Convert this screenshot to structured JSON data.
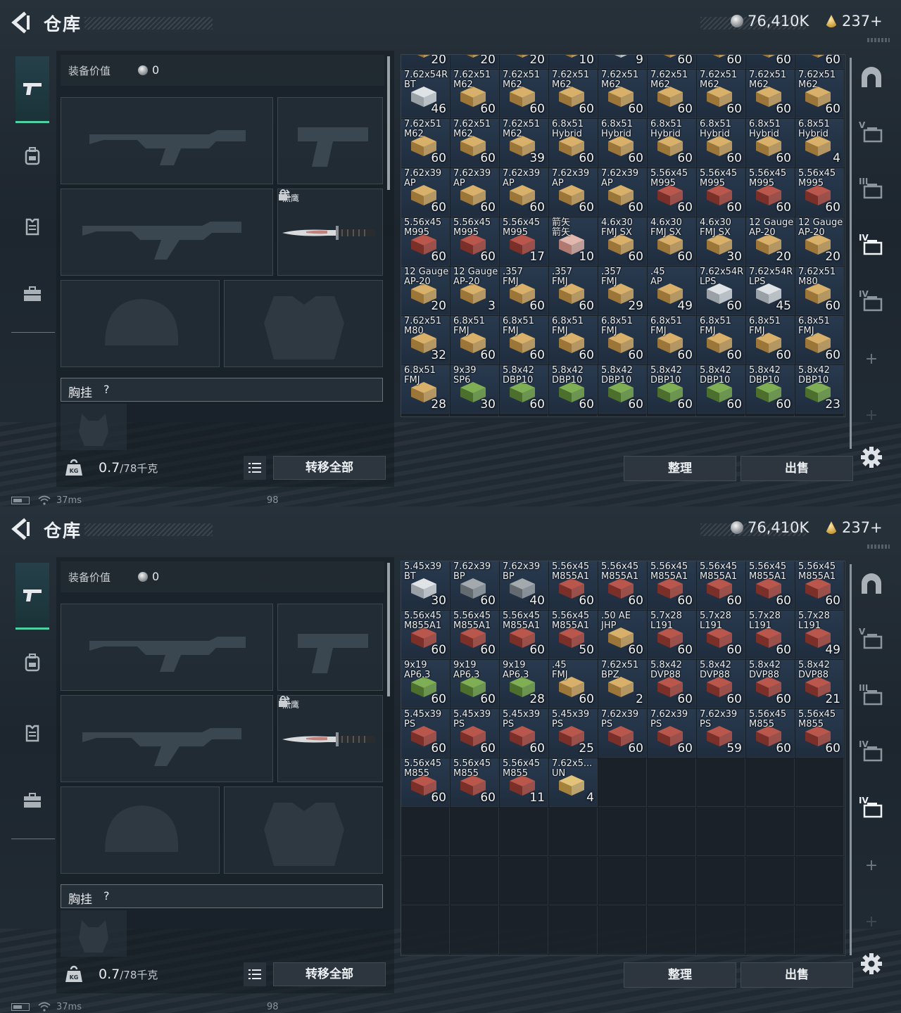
{
  "screens": [
    {
      "title": "仓库",
      "currency": {
        "silver": "76,410K",
        "gold": "237+"
      },
      "equip_value": {
        "label": "装备价值",
        "value": "0"
      },
      "knife_name": "黑鹰",
      "rig_label": "胸挂",
      "rig_help": "?",
      "weight": {
        "current": "0.7",
        "max": "/78千克"
      },
      "buttons": {
        "transfer_all": "转移全部",
        "sort": "整理",
        "sell": "出售"
      },
      "status": {
        "ping": "37ms",
        "fps": "98"
      },
      "grid_scroll_offset_rows": 0.7,
      "grid_rows": 8,
      "items": [
        {
          "name": "",
          "qty": "20",
          "color": "gold"
        },
        {
          "name": "",
          "qty": "20",
          "color": "gold"
        },
        {
          "name": "",
          "qty": "20",
          "color": "gold"
        },
        {
          "name": "",
          "qty": "10",
          "color": "gold"
        },
        {
          "name": "",
          "qty": "9",
          "color": "white"
        },
        {
          "name": "",
          "qty": "60",
          "color": "gold"
        },
        {
          "name": "",
          "qty": "60",
          "color": "gold"
        },
        {
          "name": "",
          "qty": "60",
          "color": "gold"
        },
        {
          "name": "",
          "qty": "60",
          "color": "gold"
        },
        {
          "name": "7.62x54R\nBT",
          "qty": "46",
          "color": "white"
        },
        {
          "name": "7.62x51\nM62",
          "qty": "60",
          "color": "gold"
        },
        {
          "name": "7.62x51\nM62",
          "qty": "60",
          "color": "gold"
        },
        {
          "name": "7.62x51\nM62",
          "qty": "60",
          "color": "gold"
        },
        {
          "name": "7.62x51\nM62",
          "qty": "60",
          "color": "gold"
        },
        {
          "name": "7.62x51\nM62",
          "qty": "60",
          "color": "gold"
        },
        {
          "name": "7.62x51\nM62",
          "qty": "60",
          "color": "gold"
        },
        {
          "name": "7.62x51\nM62",
          "qty": "60",
          "color": "gold"
        },
        {
          "name": "7.62x51\nM62",
          "qty": "60",
          "color": "gold"
        },
        {
          "name": "7.62x51\nM62",
          "qty": "60",
          "color": "gold"
        },
        {
          "name": "7.62x51\nM62",
          "qty": "60",
          "color": "gold"
        },
        {
          "name": "7.62x51\nM62",
          "qty": "39",
          "color": "gold"
        },
        {
          "name": "6.8x51\nHybrid",
          "qty": "60",
          "color": "gold"
        },
        {
          "name": "6.8x51\nHybrid",
          "qty": "60",
          "color": "gold"
        },
        {
          "name": "6.8x51\nHybrid",
          "qty": "60",
          "color": "gold"
        },
        {
          "name": "6.8x51\nHybrid",
          "qty": "60",
          "color": "gold"
        },
        {
          "name": "6.8x51\nHybrid",
          "qty": "60",
          "color": "gold"
        },
        {
          "name": "6.8x51\nHybrid",
          "qty": "4",
          "color": "gold"
        },
        {
          "name": "7.62x39\nAP",
          "qty": "60",
          "color": "gold"
        },
        {
          "name": "7.62x39\nAP",
          "qty": "60",
          "color": "gold"
        },
        {
          "name": "7.62x39\nAP",
          "qty": "60",
          "color": "gold"
        },
        {
          "name": "7.62x39\nAP",
          "qty": "60",
          "color": "gold"
        },
        {
          "name": "7.62x39\nAP",
          "qty": "60",
          "color": "gold"
        },
        {
          "name": "5.56x45\nM995",
          "qty": "60",
          "color": "red"
        },
        {
          "name": "5.56x45\nM995",
          "qty": "60",
          "color": "red"
        },
        {
          "name": "5.56x45\nM995",
          "qty": "60",
          "color": "red"
        },
        {
          "name": "5.56x45\nM995",
          "qty": "60",
          "color": "red"
        },
        {
          "name": "5.56x45\nM995",
          "qty": "60",
          "color": "red"
        },
        {
          "name": "5.56x45\nM995",
          "qty": "60",
          "color": "red"
        },
        {
          "name": "5.56x45\nM995",
          "qty": "17",
          "color": "red"
        },
        {
          "name": "箭矢\n箭矢",
          "qty": "10",
          "color": "pink"
        },
        {
          "name": "4.6x30\nFMJ SX",
          "qty": "60",
          "color": "gold"
        },
        {
          "name": "4.6x30\nFMJ SX",
          "qty": "60",
          "color": "gold"
        },
        {
          "name": "4.6x30\nFMJ SX",
          "qty": "30",
          "color": "gold"
        },
        {
          "name": "12 Gauge\nAP-20",
          "qty": "20",
          "color": "gold"
        },
        {
          "name": "12 Gauge\nAP-20",
          "qty": "20",
          "color": "gold"
        },
        {
          "name": "12 Gauge\nAP-20",
          "qty": "20",
          "color": "gold"
        },
        {
          "name": "12 Gauge\nAP-20",
          "qty": "3",
          "color": "gold"
        },
        {
          "name": ".357\nFMJ",
          "qty": "60",
          "color": "gold"
        },
        {
          "name": ".357\nFMJ",
          "qty": "60",
          "color": "gold"
        },
        {
          "name": ".357\nFMJ",
          "qty": "29",
          "color": "gold"
        },
        {
          "name": ".45\nAP",
          "qty": "49",
          "color": "gold"
        },
        {
          "name": "7.62x54R\nLPS",
          "qty": "60",
          "color": "white"
        },
        {
          "name": "7.62x54R\nLPS",
          "qty": "45",
          "color": "white"
        },
        {
          "name": "7.62x51\nM80",
          "qty": "60",
          "color": "gold"
        },
        {
          "name": "7.62x51\nM80",
          "qty": "32",
          "color": "gold"
        },
        {
          "name": "6.8x51\nFMJ",
          "qty": "60",
          "color": "gold"
        },
        {
          "name": "6.8x51\nFMJ",
          "qty": "60",
          "color": "gold"
        },
        {
          "name": "6.8x51\nFMJ",
          "qty": "60",
          "color": "gold"
        },
        {
          "name": "6.8x51\nFMJ",
          "qty": "60",
          "color": "gold"
        },
        {
          "name": "6.8x51\nFMJ",
          "qty": "60",
          "color": "gold"
        },
        {
          "name": "6.8x51\nFMJ",
          "qty": "60",
          "color": "gold"
        },
        {
          "name": "6.8x51\nFMJ",
          "qty": "60",
          "color": "gold"
        },
        {
          "name": "6.8x51\nFMJ",
          "qty": "60",
          "color": "gold"
        },
        {
          "name": "6.8x51\nFMJ",
          "qty": "28",
          "color": "gold"
        },
        {
          "name": "9x39\nSP6",
          "qty": "30",
          "color": "green"
        },
        {
          "name": "5.8x42\nDBP10",
          "qty": "60",
          "color": "green"
        },
        {
          "name": "5.8x42\nDBP10",
          "qty": "60",
          "color": "green"
        },
        {
          "name": "5.8x42\nDBP10",
          "qty": "60",
          "color": "green"
        },
        {
          "name": "5.8x42\nDBP10",
          "qty": "60",
          "color": "green"
        },
        {
          "name": "5.8x42\nDBP10",
          "qty": "60",
          "color": "green"
        },
        {
          "name": "5.8x42\nDBP10",
          "qty": "60",
          "color": "green"
        },
        {
          "name": "5.8x42\nDBP10",
          "qty": "23",
          "color": "green"
        }
      ]
    },
    {
      "title": "仓库",
      "currency": {
        "silver": "76,410K",
        "gold": "237+"
      },
      "equip_value": {
        "label": "装备价值",
        "value": "0"
      },
      "knife_name": "黑鹰",
      "rig_label": "胸挂",
      "rig_help": "?",
      "weight": {
        "current": "0.7",
        "max": "/78千克"
      },
      "buttons": {
        "transfer_all": "转移全部",
        "sort": "整理",
        "sell": "出售"
      },
      "status": {
        "ping": "37ms",
        "fps": "98"
      },
      "grid_scroll_offset_rows": 0,
      "grid_rows": 8,
      "items": [
        {
          "name": "5.45x39\nBT",
          "qty": "30",
          "color": "white"
        },
        {
          "name": "7.62x39\nBP",
          "qty": "60",
          "color": "gray"
        },
        {
          "name": "7.62x39\nBP",
          "qty": "40",
          "color": "gray"
        },
        {
          "name": "5.56x45\nM855A1",
          "qty": "60",
          "color": "red"
        },
        {
          "name": "5.56x45\nM855A1",
          "qty": "60",
          "color": "red"
        },
        {
          "name": "5.56x45\nM855A1",
          "qty": "60",
          "color": "red"
        },
        {
          "name": "5.56x45\nM855A1",
          "qty": "60",
          "color": "red"
        },
        {
          "name": "5.56x45\nM855A1",
          "qty": "60",
          "color": "red"
        },
        {
          "name": "5.56x45\nM855A1",
          "qty": "60",
          "color": "red"
        },
        {
          "name": "5.56x45\nM855A1",
          "qty": "60",
          "color": "red"
        },
        {
          "name": "5.56x45\nM855A1",
          "qty": "60",
          "color": "red"
        },
        {
          "name": "5.56x45\nM855A1",
          "qty": "60",
          "color": "red"
        },
        {
          "name": "5.56x45\nM855A1",
          "qty": "50",
          "color": "red"
        },
        {
          "name": ".50 AE\nJHP",
          "qty": "60",
          "color": "gold"
        },
        {
          "name": "5.7x28\nL191",
          "qty": "60",
          "color": "red"
        },
        {
          "name": "5.7x28\nL191",
          "qty": "60",
          "color": "red"
        },
        {
          "name": "5.7x28\nL191",
          "qty": "60",
          "color": "red"
        },
        {
          "name": "5.7x28\nL191",
          "qty": "49",
          "color": "red"
        },
        {
          "name": "9x19\nAP6.3",
          "qty": "60",
          "color": "green"
        },
        {
          "name": "9x19\nAP6.3",
          "qty": "60",
          "color": "green"
        },
        {
          "name": "9x19\nAP6.3",
          "qty": "28",
          "color": "green"
        },
        {
          "name": ".45\nFMJ",
          "qty": "60",
          "color": "gold"
        },
        {
          "name": "7.62x51\nBPZ",
          "qty": "2",
          "color": "gold"
        },
        {
          "name": "5.8x42\nDVP88",
          "qty": "60",
          "color": "red"
        },
        {
          "name": "5.8x42\nDVP88",
          "qty": "60",
          "color": "red"
        },
        {
          "name": "5.8x42\nDVP88",
          "qty": "60",
          "color": "red"
        },
        {
          "name": "5.8x42\nDVP88",
          "qty": "21",
          "color": "red"
        },
        {
          "name": "5.45x39\nPS",
          "qty": "60",
          "color": "red"
        },
        {
          "name": "5.45x39\nPS",
          "qty": "60",
          "color": "red"
        },
        {
          "name": "5.45x39\nPS",
          "qty": "60",
          "color": "red"
        },
        {
          "name": "5.45x39\nPS",
          "qty": "25",
          "color": "red"
        },
        {
          "name": "7.62x39\nPS",
          "qty": "60",
          "color": "red"
        },
        {
          "name": "7.62x39\nPS",
          "qty": "60",
          "color": "red"
        },
        {
          "name": "7.62x39\nPS",
          "qty": "59",
          "color": "red"
        },
        {
          "name": "5.56x45\nM855",
          "qty": "60",
          "color": "red"
        },
        {
          "name": "5.56x45\nM855",
          "qty": "60",
          "color": "red"
        },
        {
          "name": "5.56x45\nM855",
          "qty": "60",
          "color": "red"
        },
        {
          "name": "5.56x45\nM855",
          "qty": "60",
          "color": "red"
        },
        {
          "name": "5.56x45\nM855",
          "qty": "11",
          "color": "red"
        },
        {
          "name": "7.62x5...\nUN",
          "qty": "4",
          "color": "yellow"
        }
      ]
    }
  ],
  "colors": {
    "accent": "#4fd1a5",
    "box_gold": "#c9a05a",
    "box_red": "#a8443c",
    "box_green": "#6f9b4a",
    "box_white": "#c9cfd3"
  },
  "icons": {
    "left_nav": [
      "pistol-icon",
      "backpack-icon",
      "armor-vest-icon",
      "briefcase-icon"
    ],
    "right_nav": [
      "safe-icon",
      "stash-tab-v-icon",
      "stash-tab-iii-icon",
      "stash-tab-iv-icon",
      "stash-tab-iv-alt-icon",
      "add-tab-icon",
      "add-tab-disabled-icon"
    ],
    "right_nav_labels": [
      "",
      "V",
      "III",
      "IV",
      "IV",
      "+",
      "+"
    ]
  }
}
